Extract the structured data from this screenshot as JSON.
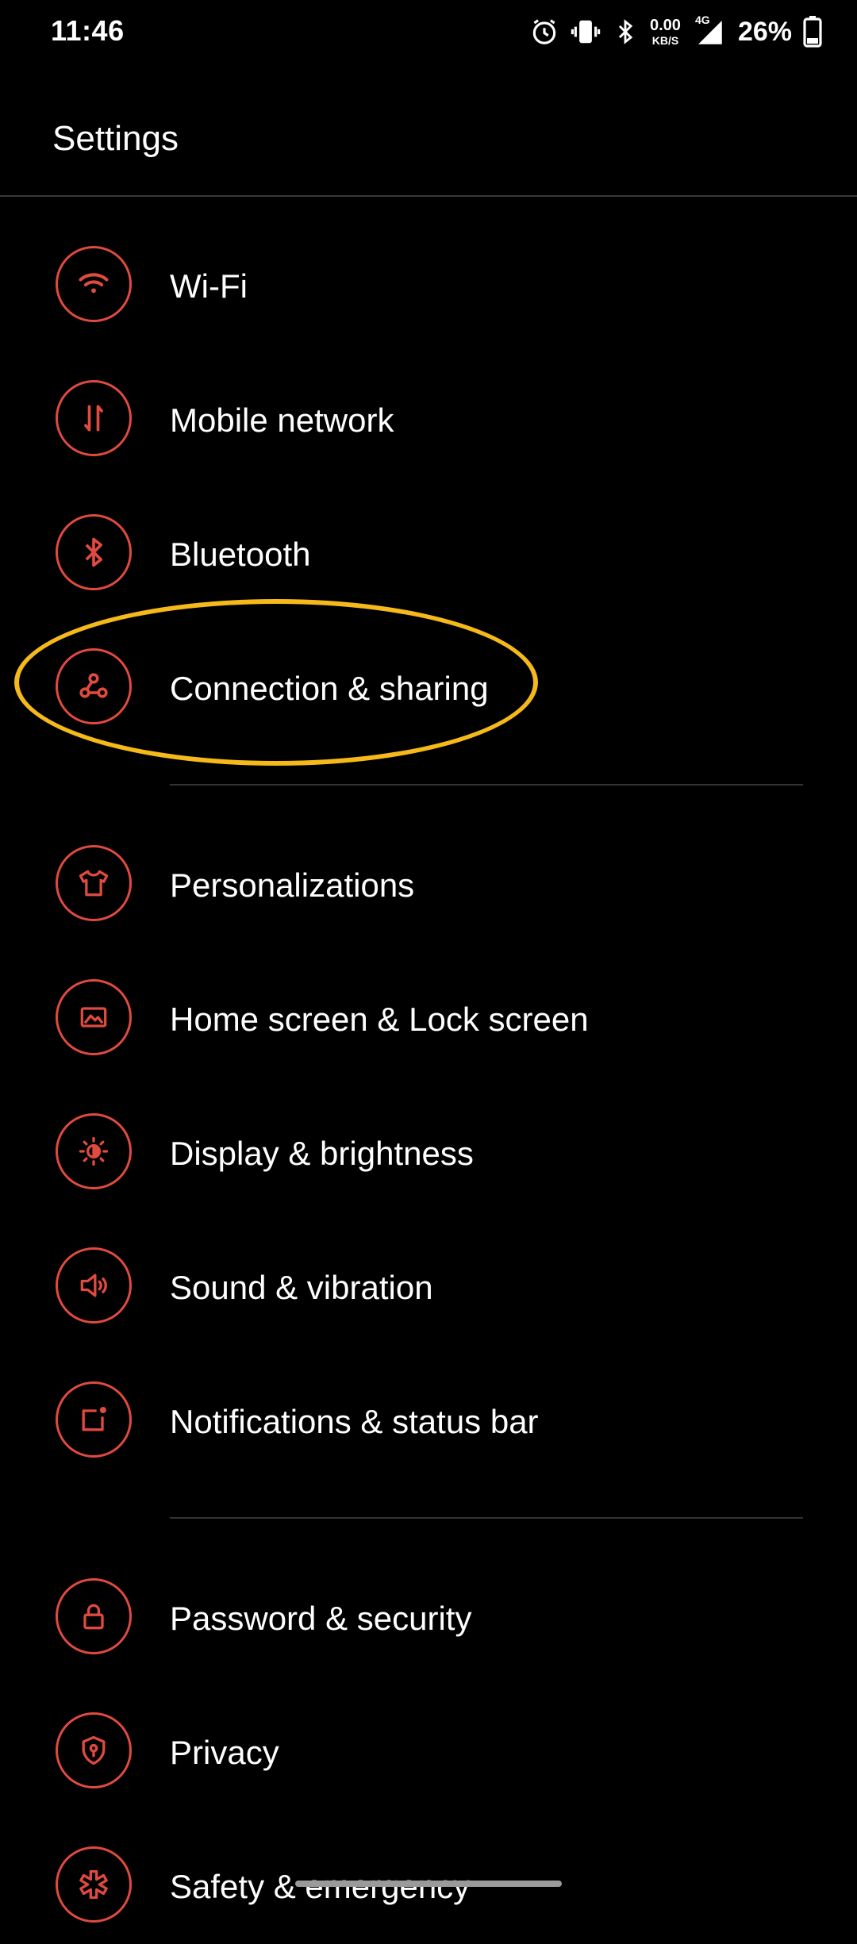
{
  "status_bar": {
    "time": "11:46",
    "net_speed_value": "0.00",
    "net_speed_unit": "KB/S",
    "network_type": "4G",
    "battery_percent": "26%"
  },
  "header": {
    "title": "Settings"
  },
  "settings_items": [
    {
      "label": "Wi-Fi",
      "icon": "wifi-icon"
    },
    {
      "label": "Mobile network",
      "icon": "mobile-data-icon"
    },
    {
      "label": "Bluetooth",
      "icon": "bluetooth-icon"
    },
    {
      "label": "Connection & sharing",
      "icon": "connection-sharing-icon"
    },
    {
      "label": "Personalizations",
      "icon": "tshirt-icon"
    },
    {
      "label": "Home screen & Lock screen",
      "icon": "image-frame-icon"
    },
    {
      "label": "Display & brightness",
      "icon": "brightness-icon"
    },
    {
      "label": "Sound & vibration",
      "icon": "speaker-icon"
    },
    {
      "label": "Notifications & status bar",
      "icon": "notification-icon"
    },
    {
      "label": "Password & security",
      "icon": "lock-icon"
    },
    {
      "label": "Privacy",
      "icon": "privacy-shield-icon"
    },
    {
      "label": "Safety & emergency",
      "icon": "emergency-icon"
    }
  ],
  "colors": {
    "accent": "#e04a3f",
    "highlight": "#f5b919",
    "background": "#000000",
    "text": "#ffffff"
  }
}
